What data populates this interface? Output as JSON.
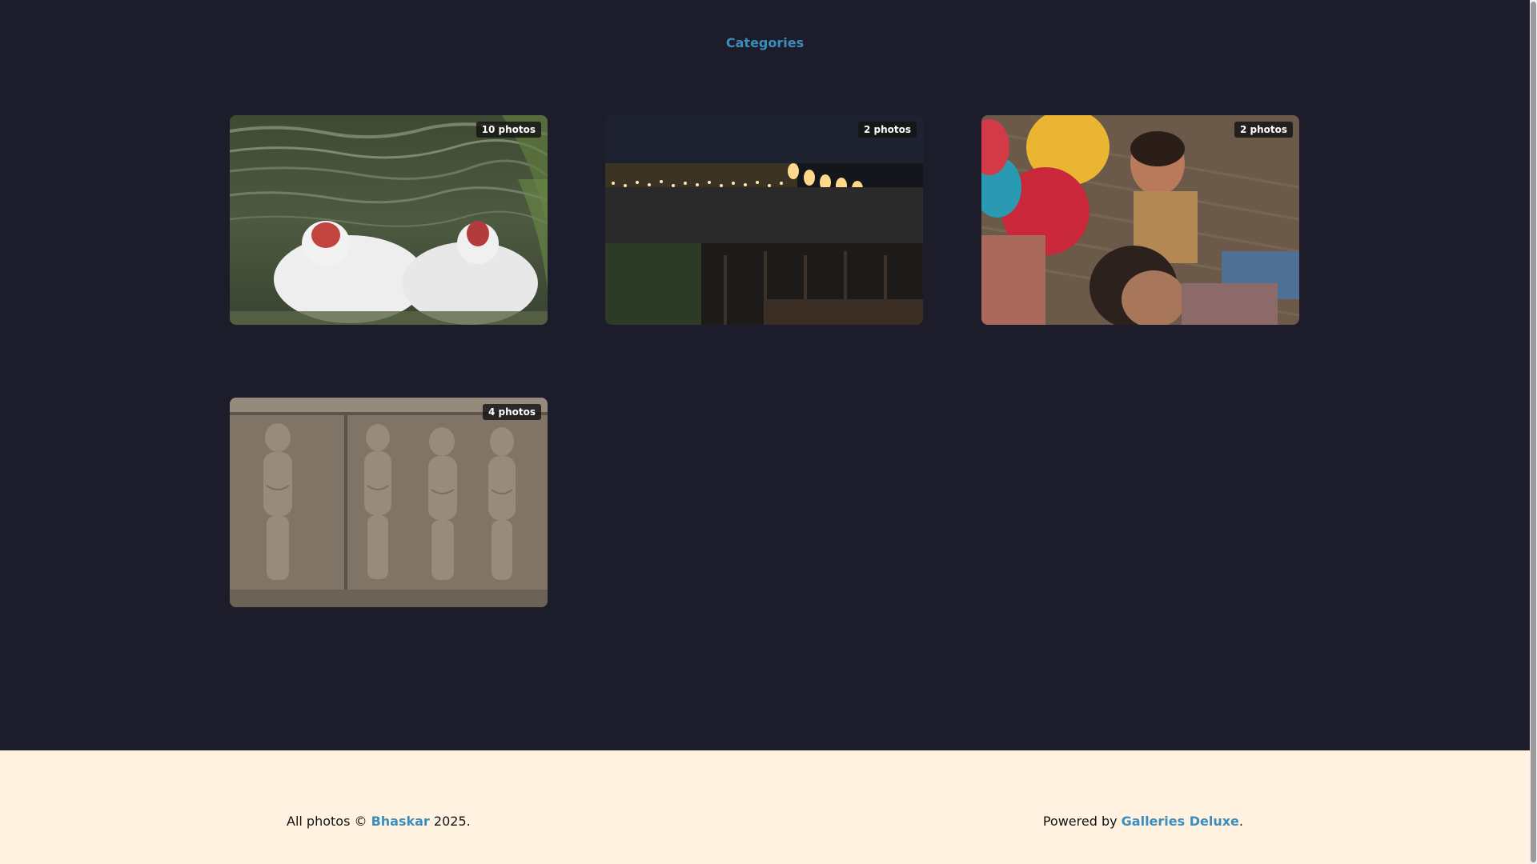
{
  "nav": {
    "title": "Categories"
  },
  "albums": [
    {
      "badge": "10 photos"
    },
    {
      "badge": "2 photos"
    },
    {
      "badge": "2 photos"
    },
    {
      "badge": "4 photos"
    }
  ],
  "footer": {
    "left_prefix": "All photos © ",
    "author": "Bhaskar",
    "left_suffix": " 2025.",
    "right_prefix": "Powered by ",
    "powered_by": "Galleries Deluxe",
    "right_suffix": "."
  },
  "colors": {
    "background": "#1c1c2b",
    "accent": "#3b8dbd",
    "footer_background": "#fff2e0"
  }
}
